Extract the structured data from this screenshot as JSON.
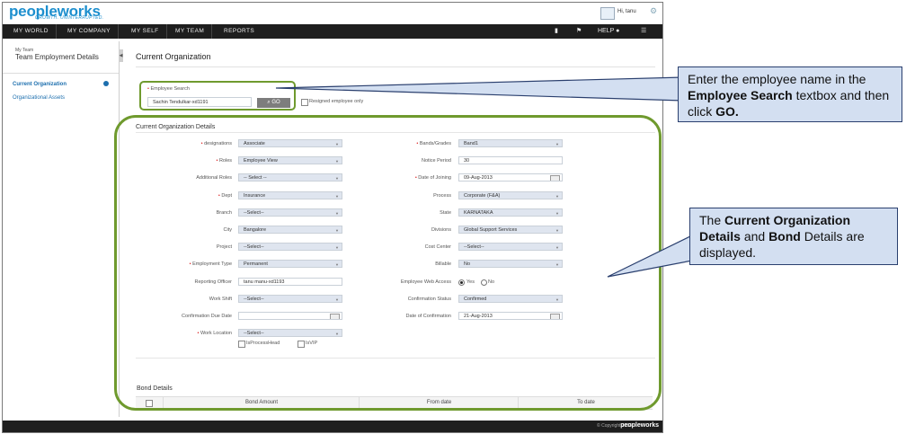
{
  "header": {
    "logo": "peopleworks",
    "tagline": "GROWTH. UNINTERRUPTED.",
    "greeting": "Hi, tanu"
  },
  "nav": {
    "items": [
      "MY WORLD",
      "MY COMPANY",
      "MY SELF",
      "MY TEAM",
      "REPORTS"
    ],
    "help": "HELP"
  },
  "sidebar": {
    "small": "My Team",
    "title": "Team Employment Details",
    "items": [
      "Current Organization",
      "Organizational Assets"
    ]
  },
  "page": {
    "title": "Current Organization"
  },
  "search": {
    "label": "Employee Search",
    "value": "Sachin Tendulkar-xd1191",
    "go": "GO",
    "resigned": "Resigned employee only"
  },
  "details": {
    "title": "Current Organization Details",
    "left": [
      {
        "label": "designations",
        "value": "Associate",
        "req": true,
        "type": "select"
      },
      {
        "label": "Roles",
        "value": "Employee View",
        "req": true,
        "type": "select"
      },
      {
        "label": "Additional Roles",
        "value": "-- Select --",
        "req": false,
        "type": "select"
      },
      {
        "label": "Dept",
        "value": "Insurance",
        "req": true,
        "type": "select"
      },
      {
        "label": "Branch",
        "value": "--Select--",
        "req": false,
        "type": "select"
      },
      {
        "label": "City",
        "value": "Bangalore",
        "req": false,
        "type": "select"
      },
      {
        "label": "Project",
        "value": "--Select--",
        "req": false,
        "type": "select"
      },
      {
        "label": "Employment Type",
        "value": "Permanent",
        "req": true,
        "type": "select"
      },
      {
        "label": "Reporting Officer",
        "value": "tanu manu-xd1193",
        "req": false,
        "type": "text"
      },
      {
        "label": "Work Shift",
        "value": "--Select--",
        "req": false,
        "type": "select"
      },
      {
        "label": "Confirmation Due Date",
        "value": "",
        "req": false,
        "type": "date"
      },
      {
        "label": "Work Location",
        "value": "--Select--",
        "req": true,
        "type": "select"
      }
    ],
    "right": [
      {
        "label": "Bands/Grades",
        "value": "Band1",
        "req": true,
        "type": "select"
      },
      {
        "label": "Notice Period",
        "value": "30",
        "req": false,
        "type": "text"
      },
      {
        "label": "Date of Joining",
        "value": "09-Aug-2013",
        "req": true,
        "type": "date"
      },
      {
        "label": "Process",
        "value": "Corporate (F&A)",
        "req": false,
        "type": "select"
      },
      {
        "label": "State",
        "value": "KARNATAKA",
        "req": false,
        "type": "select"
      },
      {
        "label": "Divisions",
        "value": "Global Support Services",
        "req": false,
        "type": "select"
      },
      {
        "label": "Cost Center",
        "value": "--Select--",
        "req": false,
        "type": "select"
      },
      {
        "label": "Billable",
        "value": "No",
        "req": false,
        "type": "select"
      },
      {
        "label": "Employee Web Access",
        "value": "",
        "req": false,
        "type": "radio"
      },
      {
        "label": "Confirmation Status",
        "value": "Confirmed",
        "req": false,
        "type": "select"
      },
      {
        "label": "Date of Confirmation",
        "value": "21-Aug-2013",
        "req": false,
        "type": "date"
      }
    ],
    "web_access": {
      "yes": "Yes",
      "no": "No"
    },
    "checkboxes": [
      "IsProcessHead",
      "IsVIP"
    ]
  },
  "bond": {
    "title": "Bond Details",
    "columns": [
      "Bond Amount",
      "From date",
      "To date"
    ]
  },
  "footer": {
    "copyright": "© Copyright 2014",
    "logo": "peopleworks"
  },
  "callouts": {
    "search": {
      "pre": "Enter the employee name in the",
      "bold1": "Employee Search",
      "mid": "textbox and then click",
      "bold2": "GO."
    },
    "details": {
      "pre": "The",
      "bold1": "Current Organization Details",
      "mid": "and",
      "bold2": "Bond",
      "post": "Details are displayed."
    }
  },
  "colors": {
    "highlight": "#6f9a2e",
    "callout_bg": "#d3dff1",
    "nav_bg": "#1e1e1e",
    "link": "#1d6fae"
  }
}
